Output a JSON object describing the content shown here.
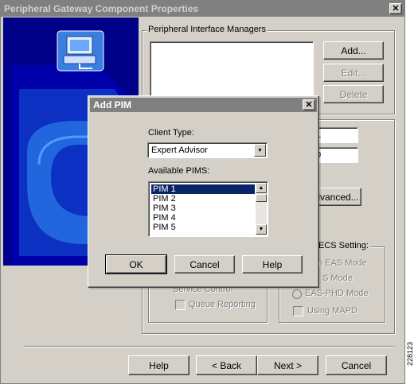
{
  "window": {
    "title": "Peripheral Gateway Component Properties",
    "close_glyph": "✕"
  },
  "pim_group": {
    "label": "Peripheral Interface Managers",
    "buttons": {
      "add": "Add...",
      "edit": "Edit...",
      "delete": "Delete"
    }
  },
  "fields": {
    "peripheral_id_partial": "1",
    "second_partial": "0"
  },
  "advanced_label": "dvanced...",
  "ecs": {
    "label": "ECS Setting:",
    "options": [
      "n EAS Mode",
      "S Mode",
      "EAS-PHD Mode"
    ],
    "using_mapd": "Using MAPD"
  },
  "service": {
    "service_control": "Service Control",
    "queue_reporting": "Queue Reporting"
  },
  "footer": {
    "help": "Help",
    "back": "< Back",
    "next": "Next >",
    "cancel": "Cancel"
  },
  "side_id": "228123",
  "dialog": {
    "title": "Add PIM",
    "client_type_label": "Client Type:",
    "client_type_value": "Expert Advisor",
    "available_pims_label": "Available PIMS:",
    "pims": [
      "PIM 1",
      "PIM 2",
      "PIM 3",
      "PIM 4",
      "PIM 5"
    ],
    "selected_pim": "PIM 1",
    "buttons": {
      "ok": "OK",
      "cancel": "Cancel",
      "help": "Help"
    }
  },
  "colors": {
    "title_inactive": "#808080",
    "face": "#d4d0c8",
    "selection": "#0a246a",
    "banner": "#000088"
  }
}
